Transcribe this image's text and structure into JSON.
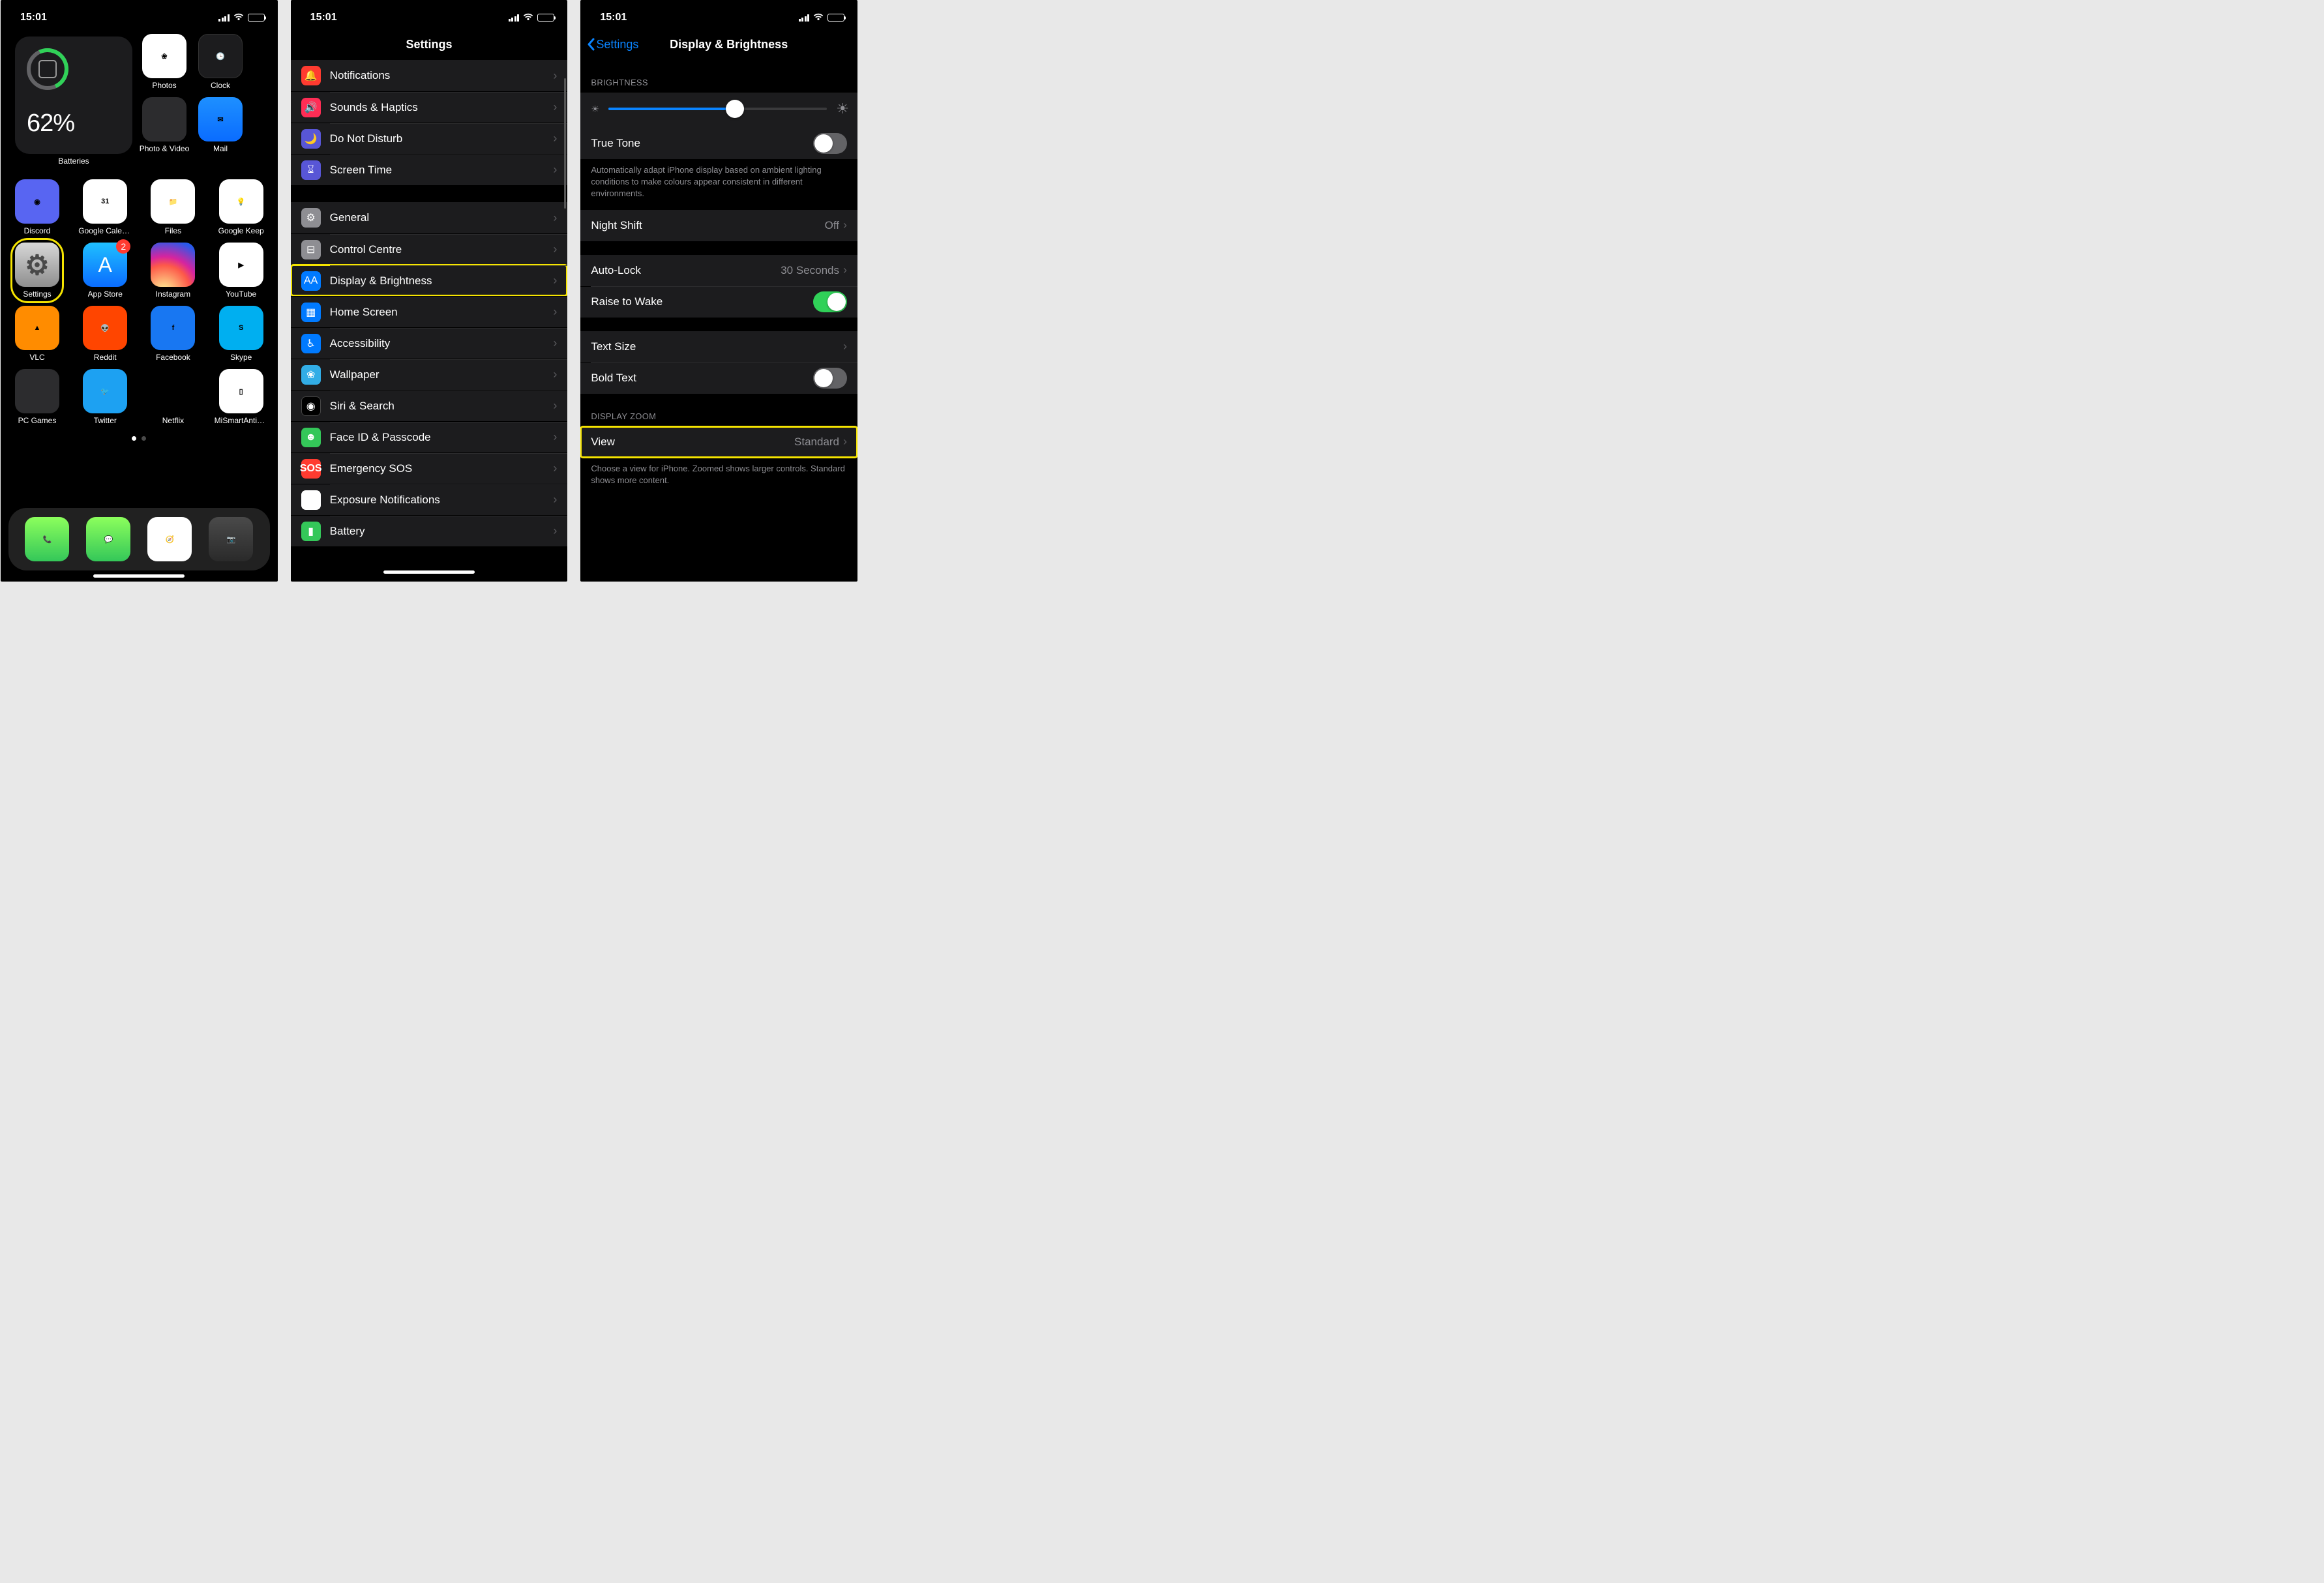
{
  "status": {
    "time": "15:01"
  },
  "home": {
    "widget": {
      "label": "Batteries",
      "percent": "62%"
    },
    "row1_right": [
      {
        "name": "Photos",
        "cls": "photos",
        "icon": "photos-icon"
      },
      {
        "name": "Clock",
        "cls": "clock",
        "icon": "clock-icon"
      }
    ],
    "row1b_right": [
      {
        "name": "Photo & Video",
        "cls": "folder",
        "icon": "folder-icon"
      },
      {
        "name": "Mail",
        "cls": "mail",
        "icon": "mail-icon"
      }
    ],
    "rows": [
      [
        {
          "name": "Discord",
          "cls": "discord",
          "icon": "discord-icon",
          "badge": ""
        },
        {
          "name": "Google Calendar",
          "cls": "gcal",
          "icon": "calendar-icon",
          "badge": ""
        },
        {
          "name": "Files",
          "cls": "files",
          "icon": "files-icon",
          "badge": ""
        },
        {
          "name": "Google Keep",
          "cls": "keep",
          "icon": "keep-icon",
          "badge": ""
        }
      ],
      [
        {
          "name": "Settings",
          "cls": "settings-ic",
          "icon": "gear-icon",
          "badge": "",
          "hl": true
        },
        {
          "name": "App Store",
          "cls": "appstore",
          "icon": "appstore-icon",
          "badge": "2"
        },
        {
          "name": "Instagram",
          "cls": "insta",
          "icon": "instagram-icon",
          "badge": ""
        },
        {
          "name": "YouTube",
          "cls": "youtube",
          "icon": "youtube-icon",
          "badge": ""
        }
      ],
      [
        {
          "name": "VLC",
          "cls": "vlc",
          "icon": "vlc-icon",
          "badge": ""
        },
        {
          "name": "Reddit",
          "cls": "reddit",
          "icon": "reddit-icon",
          "badge": ""
        },
        {
          "name": "Facebook",
          "cls": "facebook",
          "icon": "facebook-icon",
          "badge": ""
        },
        {
          "name": "Skype",
          "cls": "skype",
          "icon": "skype-icon",
          "badge": ""
        }
      ],
      [
        {
          "name": "PC Games",
          "cls": "folder",
          "icon": "folder-icon",
          "badge": ""
        },
        {
          "name": "Twitter",
          "cls": "twitter",
          "icon": "twitter-icon",
          "badge": ""
        },
        {
          "name": "Netflix",
          "cls": "netflix",
          "icon": "netflix-icon",
          "badge": ""
        },
        {
          "name": "MiSmartAntiba...",
          "cls": "mismart",
          "icon": "mismart-icon",
          "badge": ""
        }
      ]
    ],
    "dock": [
      {
        "name": "Phone",
        "cls": "phone-ic",
        "icon": "phone-icon"
      },
      {
        "name": "Messages",
        "cls": "msg-ic",
        "icon": "messages-icon"
      },
      {
        "name": "Safari",
        "cls": "safari",
        "icon": "safari-icon"
      },
      {
        "name": "Camera",
        "cls": "camera",
        "icon": "camera-icon"
      }
    ]
  },
  "settings": {
    "title": "Settings",
    "groups": [
      [
        {
          "label": "Notifications",
          "icon": "🔔",
          "color": "ic-red"
        },
        {
          "label": "Sounds & Haptics",
          "icon": "🔊",
          "color": "ic-pink"
        },
        {
          "label": "Do Not Disturb",
          "icon": "🌙",
          "color": "ic-indigo"
        },
        {
          "label": "Screen Time",
          "icon": "⌛︎",
          "color": "ic-indigo"
        }
      ],
      [
        {
          "label": "General",
          "icon": "⚙︎",
          "color": "ic-grey"
        },
        {
          "label": "Control Centre",
          "icon": "⊟",
          "color": "ic-grey"
        },
        {
          "label": "Display & Brightness",
          "icon": "AA",
          "color": "ic-blue",
          "hl": true
        },
        {
          "label": "Home Screen",
          "icon": "▦",
          "color": "ic-blue"
        },
        {
          "label": "Accessibility",
          "icon": "♿︎",
          "color": "ic-blue"
        },
        {
          "label": "Wallpaper",
          "icon": "❀",
          "color": "ic-cyan"
        },
        {
          "label": "Siri & Search",
          "icon": "◉",
          "color": "ic-black"
        },
        {
          "label": "Face ID & Passcode",
          "icon": "☻",
          "color": "ic-green"
        },
        {
          "label": "Emergency SOS",
          "icon": "SOS",
          "color": "ic-sos"
        },
        {
          "label": "Exposure Notifications",
          "icon": "✱",
          "color": "ic-cov"
        },
        {
          "label": "Battery",
          "icon": "▮",
          "color": "ic-green"
        }
      ]
    ]
  },
  "display": {
    "back": "Settings",
    "title": "Display & Brightness",
    "section_brightness": "BRIGHTNESS",
    "truetone": "True Tone",
    "truetone_desc": "Automatically adapt iPhone display based on ambient lighting conditions to make colours appear consistent in different environments.",
    "nightshift_label": "Night Shift",
    "nightshift_value": "Off",
    "autolock_label": "Auto-Lock",
    "autolock_value": "30 Seconds",
    "raise_label": "Raise to Wake",
    "textsize": "Text Size",
    "boldtext": "Bold Text",
    "section_zoom": "DISPLAY ZOOM",
    "view_label": "View",
    "view_value": "Standard",
    "view_desc": "Choose a view for iPhone. Zoomed shows larger controls. Standard shows more content."
  }
}
